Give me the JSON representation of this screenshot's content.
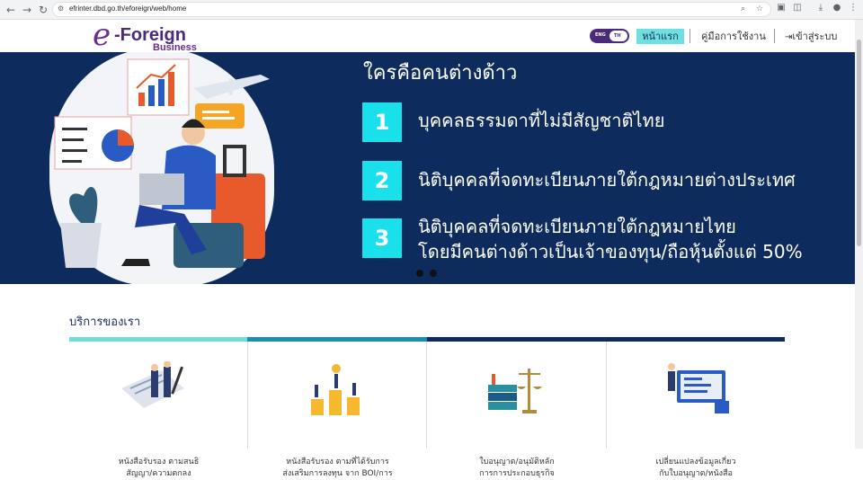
{
  "browser": {
    "url": "efrinter.dbd.go.th/eforeign/web/home"
  },
  "header": {
    "logo_e": "e",
    "logo_name": "-Foreign",
    "logo_sub": "Business",
    "lang_eng": "ENG",
    "lang_th": "TH",
    "home_label": "หน้าแรก",
    "manual_label": "คู่มือการใช้งาน",
    "login_label": "เข้าสู่ระบบ",
    "login_icon": "login-icon"
  },
  "hero": {
    "title": "ใครคือคนต่างด้าว",
    "items": [
      {
        "num": "1",
        "line1": "บุคคลธรรมดาที่ไม่มีสัญชาติไทย",
        "line2": ""
      },
      {
        "num": "2",
        "line1": "นิติบุคคลที่จดทะเบียนภายใต้กฎหมายต่างประเทศ",
        "line2": ""
      },
      {
        "num": "3",
        "line1": "นิติบุคคลที่จดทะเบียนภายใต้กฎหมายไทย",
        "line2": "โดยมีคนต่างด้าวเป็นเจ้าของทุน/ถือหุ้นตั้งแต่ 50%"
      }
    ]
  },
  "services": {
    "title": "บริการของเรา",
    "colors": [
      "#6fdcd6",
      "#1a8fb0",
      "#0d2b5c",
      "#0d2b5c"
    ],
    "cards": [
      {
        "line1": "หนังสือรับรอง ตามสนธิ",
        "line2": "สัญญา/ความตกลง",
        "icon": "handshake-contract-icon"
      },
      {
        "line1": "หนังสือรับรอง ตามที่ได้รับการ",
        "line2": "ส่งเสริมการลงทุน จาก BOI/การ",
        "icon": "coins-growth-icon"
      },
      {
        "line1": "ใบอนุญาต/อนุมัติหลัก",
        "line2": "การการประกอบธุรกิจ",
        "icon": "law-books-scale-icon"
      },
      {
        "line1": "เปลี่ยนแปลงข้อมูลเกี่ยว",
        "line2": "กับใบอนุญาต/หนังสือ",
        "icon": "data-change-icon"
      }
    ]
  }
}
